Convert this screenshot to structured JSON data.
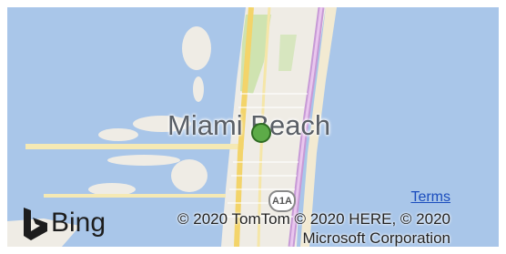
{
  "map": {
    "place_label": "Miami Beach",
    "route_shield": "A1A",
    "pin_color": "#5dab48",
    "water_color": "#a9c6e9",
    "land_color": "#efece5"
  },
  "attribution": {
    "logo_text": "Bing",
    "terms_label": "Terms",
    "copyright_line1": "© 2020 TomTom © 2020 HERE, © 2020",
    "copyright_line2": "Microsoft Corporation"
  }
}
